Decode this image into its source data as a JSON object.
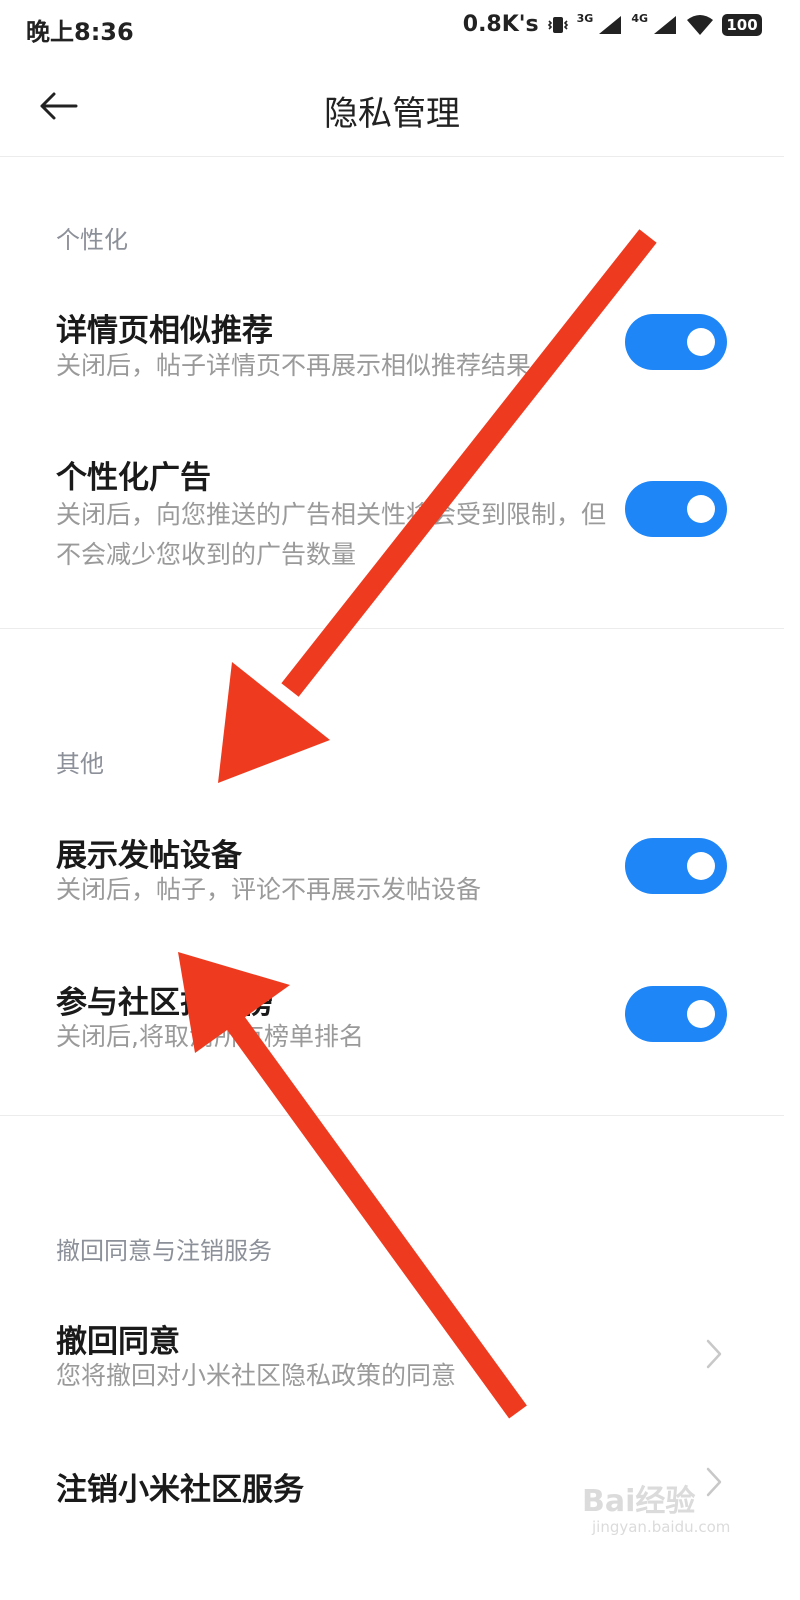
{
  "status_bar": {
    "time": "晚上8:36",
    "speed": "0.8K's",
    "network1": "3G",
    "network2": "4G",
    "battery": "100"
  },
  "header": {
    "title": "隐私管理",
    "back_icon": "arrow-left-icon"
  },
  "sections": [
    {
      "title": "个性化",
      "items": [
        {
          "title": "详情页相似推荐",
          "desc": "关闭后，帖子详情页不再展示相似推荐结果",
          "enabled": true
        },
        {
          "title": "个性化广告",
          "desc": "关闭后，向您推送的广告相关性将会受到限制，但不会减少您收到的广告数量",
          "enabled": true
        }
      ]
    },
    {
      "title": "其他",
      "items": [
        {
          "title": "展示发帖设备",
          "desc": "关闭后，帖子，评论不再展示发帖设备",
          "enabled": true
        },
        {
          "title": "参与社区排行榜",
          "desc": "关闭后,将取消所有榜单排名",
          "enabled": true
        }
      ]
    },
    {
      "title": "撤回同意与注销服务",
      "items": [
        {
          "title": "撤回同意",
          "desc": "您将撤回对小米社区隐私政策的同意"
        },
        {
          "title": "注销小米社区服务"
        }
      ]
    }
  ],
  "watermark": {
    "logo": "Bai经验",
    "sub": "jingyan.baidu.com"
  },
  "colors": {
    "accent": "#1e86f7",
    "arrow": "#ee3b1f",
    "section_title": "#8c9099",
    "desc": "#9a9a9a"
  }
}
